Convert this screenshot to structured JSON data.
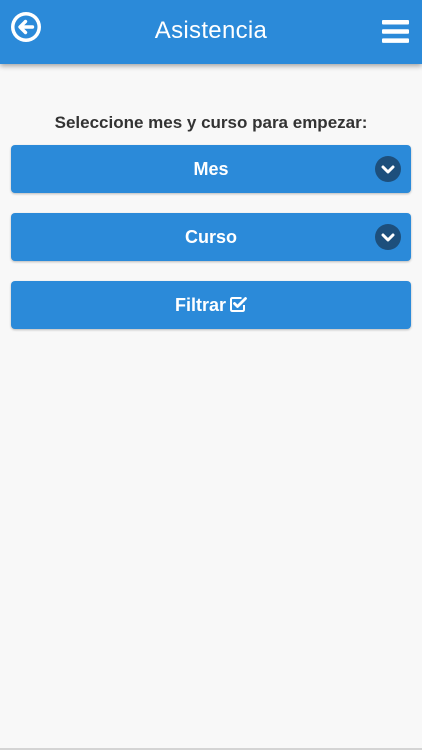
{
  "header": {
    "title": "Asistencia",
    "back_icon": "arrow-left-circle-icon",
    "menu_icon": "hamburger-menu-icon",
    "background_color": "#2b8ad9"
  },
  "main": {
    "instructions": "Seleccione mes y curso para empezar:",
    "month_select": {
      "label": "Mes",
      "icon": "chevron-down-circle-icon"
    },
    "course_select": {
      "label": "Curso",
      "icon": "chevron-down-circle-icon"
    },
    "filter_button": {
      "label": "Filtrar",
      "icon": "checkbox-checked-icon"
    }
  },
  "colors": {
    "primary": "#2b8ad9",
    "chevron_badge": "#1d4f7c",
    "page_background": "#f8f8f8",
    "text_dark": "#333333"
  }
}
